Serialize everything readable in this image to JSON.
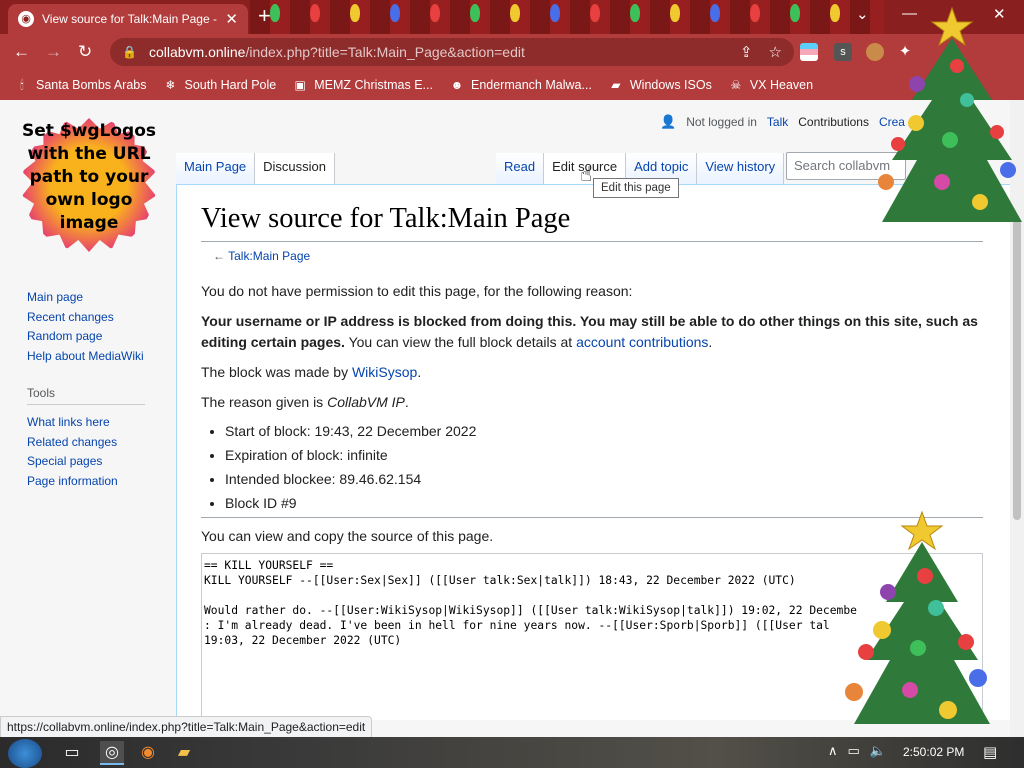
{
  "browser": {
    "tab_title": "View source for Talk:Main Page -",
    "url_host": "collabvm.online",
    "url_rest": "/index.php?title=Talk:Main_Page&action=edit",
    "bookmarks": [
      {
        "label": "Santa Bombs Arabs",
        "icon": "candle-icon"
      },
      {
        "label": "South Hard Pole",
        "icon": "snowflake-icon"
      },
      {
        "label": "MEMZ Christmas E...",
        "icon": "window-icon"
      },
      {
        "label": "Endermanch Malwa...",
        "icon": "raccoon-icon"
      },
      {
        "label": "Windows ISOs",
        "icon": "folder-icon"
      },
      {
        "label": "VX Heaven",
        "icon": "skull-icon"
      }
    ],
    "extension_s": "s"
  },
  "wiki": {
    "logo_text": "Set $wgLogos with the URL path to your own logo image",
    "personal": {
      "not_logged_in": "Not logged in",
      "talk": "Talk",
      "contributions": "Contributions",
      "create": "Crea"
    },
    "tabs_left": [
      {
        "label": "Main Page"
      },
      {
        "label": "Discussion"
      }
    ],
    "tabs_right": [
      {
        "label": "Read"
      },
      {
        "label": "Edit source"
      },
      {
        "label": "Add topic"
      },
      {
        "label": "View history"
      }
    ],
    "search_placeholder": "Search collabvm",
    "tooltip": "Edit this page",
    "sidebar_nav": [
      "Main page",
      "Recent changes",
      "Random page",
      "Help about MediaWiki"
    ],
    "tools_heading": "Tools",
    "tools": [
      "What links here",
      "Related changes",
      "Special pages",
      "Page information"
    ],
    "heading": "View source for Talk:Main Page",
    "backlink_arrow": "←",
    "backlink": "Talk:Main Page",
    "p1": "You do not have permission to edit this page, for the following reason:",
    "p2_bold": "Your username or IP address is blocked from doing this. You may still be able to do other things on this site, such as editing certain pages.",
    "p2_rest": " You can view the full block details at ",
    "p2_link": "account contributions",
    "p2_end": ".",
    "p3_pre": "The block was made by ",
    "p3_link": "WikiSysop",
    "p3_end": ".",
    "p4_pre": "The reason given is ",
    "p4_em": "CollabVM IP",
    "p4_end": ".",
    "bullets": [
      "Start of block: 19:43, 22 December 2022",
      "Expiration of block: infinite",
      "Intended blockee: 89.46.62.154",
      "Block ID #9"
    ],
    "p5": "You can view and copy the source of this page.",
    "source": "== KILL YOURSELF ==\nKILL YOURSELF --[[User:Sex|Sex]] ([[User talk:Sex|talk]]) 18:43, 22 December 2022 (UTC)\n\nWould rather do. --[[User:WikiSysop|WikiSysop]] ([[User talk:WikiSysop|talk]]) 19:02, 22 Decembe\n: I'm already dead. I've been in hell for nine years now. --[[User:Sporb|Sporb]] ([[User tal\n19:03, 22 December 2022 (UTC)"
  },
  "status_url": "https://collabvm.online/index.php?title=Talk:Main_Page&action=edit",
  "taskbar": {
    "clock": "2:50:02 PM"
  }
}
